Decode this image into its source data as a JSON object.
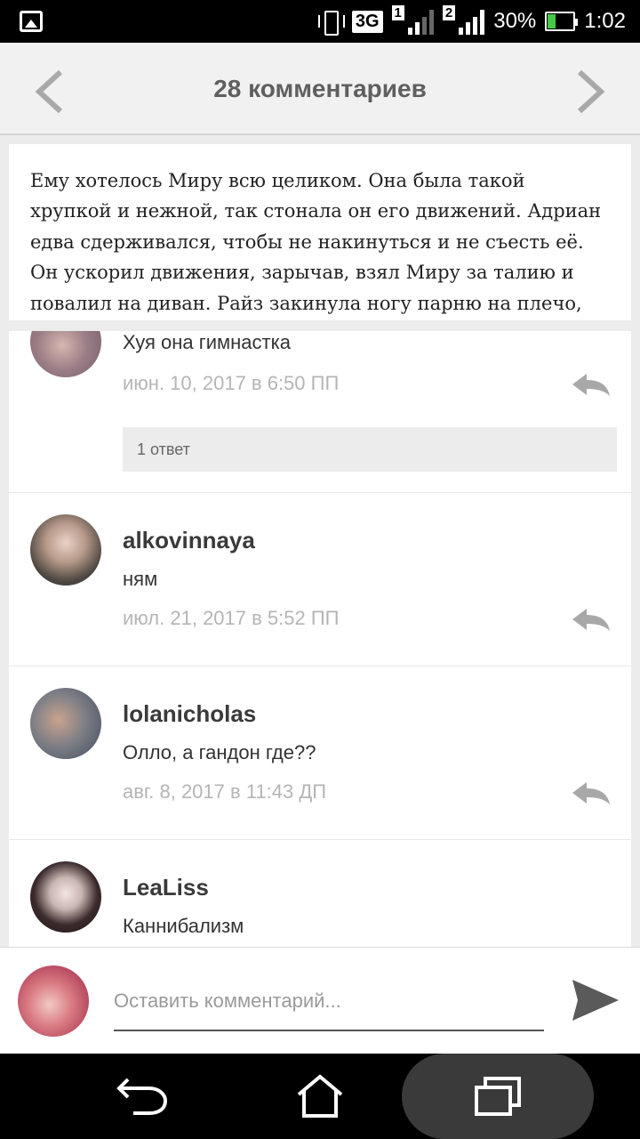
{
  "status_bar": {
    "network_type": "3G",
    "sim1": "1",
    "sim2": "2",
    "battery": "30%",
    "battery_level": 0.3,
    "time": "1:02",
    "icons": [
      "gallery-icon",
      "vibrate-icon",
      "signal-icon",
      "battery-charging-icon"
    ]
  },
  "header": {
    "title": "28 комментариев",
    "prev_icon": "chevron-left-icon",
    "next_icon": "chevron-right-icon"
  },
  "excerpt": {
    "text": "Ему хотелось Миру всю целиком. Она была такой хрупкой и нежной, так стонала он его движений. Адриан едва сдерживался, чтобы не накинуться и не съесть её. Он ускорил движения, зарычав, взял Миру за талию и повалил на диван. Райз закинула ногу парню на плечо,"
  },
  "comments": [
    {
      "username": "",
      "text": "Хуя она гимнастка",
      "date": "июн. 10, 2017 в 6:50 ПП",
      "replies_label": "1 ответ"
    },
    {
      "username": "alkovinnaya",
      "text": "ням",
      "date": "июл. 21, 2017 в 5:52 ПП"
    },
    {
      "username": "lolanicholas",
      "text": "Олло, а гандон где??",
      "date": "авг. 8, 2017 в 11:43 ДП"
    },
    {
      "username": "LeaLiss",
      "text": "Каннибализм",
      "date": ""
    }
  ],
  "comment_input": {
    "placeholder": "Оставить комментарий...",
    "send_icon": "send-icon"
  },
  "colors": {
    "header_bg": "#f1f1f1",
    "page_bg": "#ececec",
    "date_text": "#b5b5b5",
    "battery_accent": "#45c945"
  }
}
